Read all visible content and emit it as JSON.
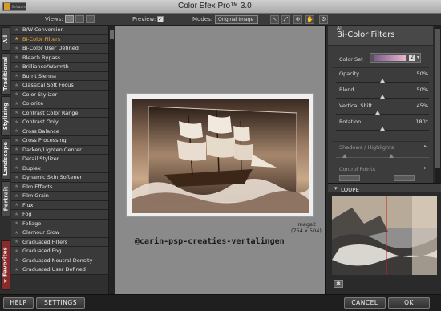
{
  "app": {
    "title_main": "Color Efex Pro",
    "title_tm": "™",
    "title_version": "3.0"
  },
  "toolbar": {
    "views_label": "Views:",
    "preview_label": "Preview:",
    "preview_checked": true,
    "modes_label": "Modes:",
    "mode_value": "Original Image"
  },
  "vtabs": {
    "all": "All",
    "traditional": "Traditional",
    "stylizing": "Stylizing",
    "landscape": "Landscape",
    "portrait": "Portrait",
    "favorites": "Favorites"
  },
  "filters": [
    "B/W Conversion",
    "Bi-Color Filters",
    "Bi-Color User Defined",
    "Bleach Bypass",
    "Brilliance/Warmth",
    "Burnt Sienna",
    "Classical Soft Focus",
    "Color Stylizer",
    "Colorize",
    "Contrast Color Range",
    "Contrast Only",
    "Cross Balance",
    "Cross Processing",
    "Darken/Lighten Center",
    "Detail Stylizer",
    "Duplex",
    "Dynamic Skin Softener",
    "Film Effects",
    "Film Grain",
    "Flux",
    "Fog",
    "Foliage",
    "Glamour Glow",
    "Graduated Filters",
    "Graduated Fog",
    "Graduated Neutral Density",
    "Graduated User Defined"
  ],
  "selected_filter_index": 1,
  "preview": {
    "image_name": "image2",
    "image_size": "(754 x 504)",
    "watermark": "@carin-psp-creaties-vertalingen"
  },
  "panel": {
    "category": "All",
    "filter_title": "Bi-Color Filters",
    "color_set_label": "Color Set",
    "color_set_value": "2",
    "opacity_label": "Opacity",
    "opacity_value": "50%",
    "blend_label": "Blend",
    "blend_value": "50%",
    "vshift_label": "Vertical Shift",
    "vshift_value": "45%",
    "rotation_label": "Rotation",
    "rotation_value": "180°",
    "shadows_label": "Shadows / Highlights",
    "control_points_label": "Control Points",
    "loupe_label": "LOUPE"
  },
  "bottom": {
    "help": "HELP",
    "settings": "SETTINGS",
    "cancel": "CANCEL",
    "ok": "OK"
  },
  "colors": {
    "accent": "#f3a733",
    "favorites_tab": "#8a2a2a",
    "preview_bg": "#8a8a8a"
  }
}
